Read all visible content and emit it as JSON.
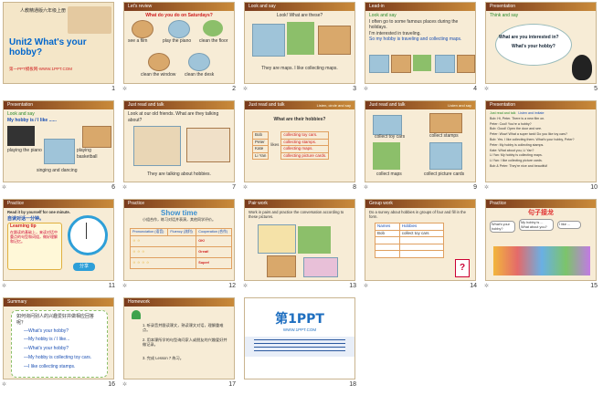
{
  "slides": [
    {
      "n": "1",
      "bar": "",
      "lines": [
        "人教精通版六年级上册",
        "Unit2 What's your hobby?",
        "第一PPT模板网-WWW.1PPT.COM"
      ]
    },
    {
      "n": "2",
      "bar": "Let's review",
      "lines": [
        "What do you do on Saturdays?",
        "see a film",
        "play the piano",
        "clean the floor",
        "clean the window",
        "clean the desk"
      ]
    },
    {
      "n": "3",
      "bar": "Look and say",
      "lines": [
        "Look! What are these?",
        "They are maps. I like collecting maps."
      ]
    },
    {
      "n": "4",
      "bar": "Lead-in",
      "lines": [
        "Look and say",
        "I often go to some famous places during the holidays.",
        "I'm interested in traveling.",
        "So my hobby is traveling and collecting maps."
      ]
    },
    {
      "n": "5",
      "bar": "Presentation",
      "lines": [
        "Think and say",
        "What are you interested in?",
        "What's your hobby?"
      ]
    },
    {
      "n": "6",
      "bar": "Presentation",
      "lines": [
        "Look and say",
        "My hobby is / I like ......",
        "playing the piano",
        "playing basketball",
        "singing and dancing"
      ]
    },
    {
      "n": "7",
      "bar": "Just read and talk",
      "lines": [
        "Look at our old friends. What are they talking about?",
        "They are talking about hobbies."
      ]
    },
    {
      "n": "8",
      "bar": "Just read and talk",
      "lines": [
        "Listen, circle and say",
        "What are their hobbies?",
        "Bob",
        "Peter",
        "Kate",
        "Li Yan",
        "likes",
        "collecting toy cars.",
        "collecting stamps.",
        "collecting maps.",
        "collecting picture cards."
      ]
    },
    {
      "n": "9",
      "bar": "Just read and talk",
      "lines": [
        "Listen and say",
        "collect toy cars",
        "collect stamps",
        "collect maps",
        "collect picture cards"
      ]
    },
    {
      "n": "10",
      "bar": "Presentation",
      "lines": [
        "Just read and talk",
        "Listen and imitate",
        "Bob: Hi, Peter. There is a new film on.",
        "Peter: Cool! You're a hobby?",
        "Bob: Good! Open the door and see.",
        "Peter: Wow! What a super tank! Do you like toy cars?",
        "Bob: Yes. I like collecting them. What's your hobby, Peter?",
        "Peter: My hobby is collecting stamps.",
        "Kate: What about you, Li Yan?",
        "Li Yan: My hobby is collecting maps.",
        "Li Yan: I like collecting picture cards.",
        "Bob & Peter: They're nice and beautiful!"
      ]
    },
    {
      "n": "11",
      "bar": "Practice",
      "lines": [
        "Read it by yourself for one minute.",
        "自读对话一分钟。",
        "Learning tip",
        "在跟读的基础上，来读对话中重点的句型和词组，做好理解和记忆。",
        "分享"
      ]
    },
    {
      "n": "12",
      "bar": "Practice",
      "lines": [
        "Show time",
        "小组合作，练习对话并表演，其他同学评价。",
        "Pronunciation (语音)",
        "Fluency (流利)",
        "Cooperation (合作)",
        "OK!",
        "Great!",
        "Super!"
      ]
    },
    {
      "n": "13",
      "bar": "Pair work",
      "lines": [
        "Work in pairs and practice the conversation according to these pictures."
      ]
    },
    {
      "n": "14",
      "bar": "Group work",
      "lines": [
        "Do a survey about hobbies in groups of four and fill in the form.",
        "Names",
        "Hobbies",
        "Bob",
        "collect toy cars"
      ]
    },
    {
      "n": "15",
      "bar": "Practice",
      "lines": [
        "句子接龙",
        "What's your hobby?",
        "My hobby is ... What about you?",
        "I like ..."
      ]
    },
    {
      "n": "16",
      "bar": "Summary",
      "lines": [
        "如何询问别人的兴趣爱好并做相应回答呢？",
        "—What's your hobby?",
        "—My hobby is / I like...",
        "—What's your hobby?",
        "—My hobby is collecting toy cars.",
        "—I like collecting stamps."
      ]
    },
    {
      "n": "17",
      "bar": "Homework",
      "lines": [
        "1. 听录音并跟读课文，熟读课文对话，理解重难点。",
        "2. 用本课所学的句型询问家人或朋友的兴趣爱好并做记录。",
        "3. 完成 Lesson 7 练习。"
      ]
    },
    {
      "n": "18",
      "bar": "",
      "lines": [
        "第1PPT",
        "WWW.1PPT.COM"
      ]
    }
  ]
}
